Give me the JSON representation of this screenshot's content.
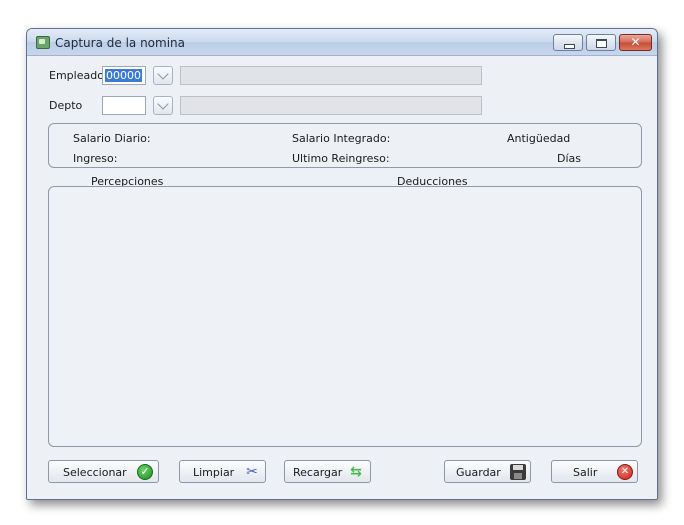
{
  "window": {
    "title": "Captura de la nomina"
  },
  "form": {
    "empleado_label": "Empleado",
    "empleado_value": "00000",
    "depto_label": "Depto",
    "depto_value": ""
  },
  "info": {
    "salario_diario": "Salario Diario:",
    "salario_integrado": "Salario Integrado:",
    "antiguedad": "Antigüedad",
    "ingreso": "Ingreso:",
    "ultimo_reingreso": "Ultimo Reingreso:",
    "dias": "Días"
  },
  "lists": {
    "percepciones": "Percepciones",
    "deducciones": "Deducciones"
  },
  "buttons": {
    "seleccionar": "Seleccionar",
    "limpiar": "Limpiar",
    "recargar": "Recargar",
    "guardar": "Guardar",
    "salir": "Salir"
  },
  "icons": {
    "seleccionar": "check-icon",
    "limpiar": "scissors-icon",
    "recargar": "refresh-icon",
    "guardar": "floppy-disk-icon",
    "salir": "close-circle-icon"
  }
}
